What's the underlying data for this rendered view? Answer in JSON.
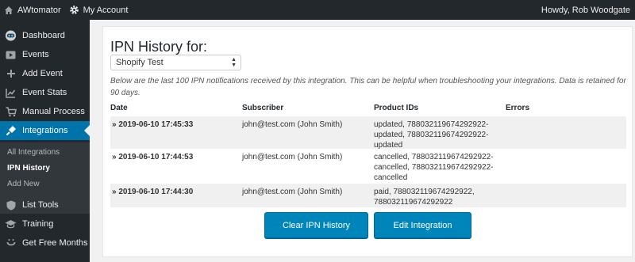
{
  "adminbar": {
    "site_name": "AWtomator",
    "account": "My Account",
    "greeting": "Howdy, Rob Woodgate"
  },
  "sidebar": {
    "items": [
      {
        "label": "Dashboard",
        "icon": "robot-icon"
      },
      {
        "label": "Events",
        "icon": "play-icon"
      },
      {
        "label": "Add Event",
        "icon": "plus-icon"
      },
      {
        "label": "Event Stats",
        "icon": "chart-icon"
      },
      {
        "label": "Manual Process",
        "icon": "cart-icon"
      },
      {
        "label": "Integrations",
        "icon": "plug-icon"
      },
      {
        "label": "List Tools",
        "icon": "shield-icon"
      },
      {
        "label": "Training",
        "icon": "mortarboard-icon"
      },
      {
        "label": "Get Free Months",
        "icon": "smile-icon"
      }
    ],
    "submenu": [
      {
        "label": "All Integrations"
      },
      {
        "label": "IPN History"
      },
      {
        "label": "Add New"
      }
    ]
  },
  "page": {
    "heading": "IPN History for:",
    "select_value": "Shopify Test",
    "description": "Below are the last 100 IPN notifications received by this integration. This can be helpful when troubleshooting your integrations. Data is retained for 90 days."
  },
  "table": {
    "headers": [
      "Date",
      "Subscriber",
      "Product IDs",
      "Errors"
    ],
    "rows": [
      {
        "date": "» 2019-06-10 17:45:33",
        "subscriber": "john@test.com (John Smith)",
        "products": "updated, 788032119674292922-updated, 788032119674292922-updated",
        "errors": ""
      },
      {
        "date": "» 2019-06-10 17:44:53",
        "subscriber": "john@test.com (John Smith)",
        "products": "cancelled, 788032119674292922-cancelled, 788032119674292922-cancelled",
        "errors": ""
      },
      {
        "date": "» 2019-06-10 17:44:30",
        "subscriber": "john@test.com (John Smith)",
        "products": "paid, 788032119674292922, 788032119674292922",
        "errors": ""
      }
    ]
  },
  "buttons": {
    "clear": "Clear IPN History",
    "edit": "Edit Integration"
  },
  "colors": {
    "adminbar": "#23282d",
    "accent": "#0073aa",
    "button": "#0085ba"
  }
}
